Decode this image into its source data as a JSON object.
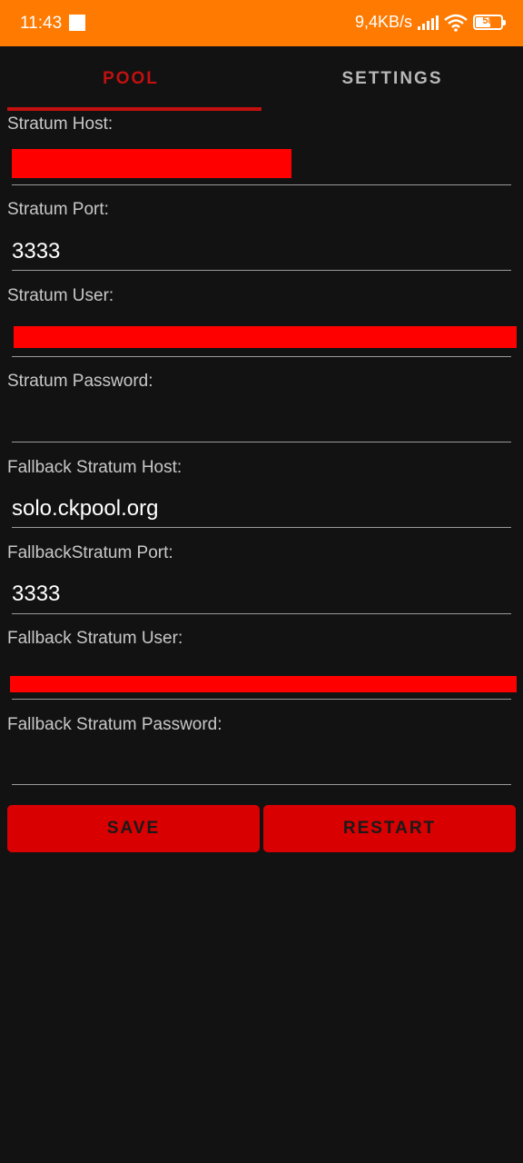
{
  "status_bar": {
    "time": "11:43",
    "network_speed": "9,4KB/s",
    "battery_level": "58",
    "background_color": "#ff7a00",
    "icons": [
      "signal-icon",
      "wifi-icon",
      "battery-icon"
    ]
  },
  "tabs": [
    {
      "label": "POOL",
      "active": true
    },
    {
      "label": "SETTINGS",
      "active": false
    }
  ],
  "accent_color": "#c21010",
  "fields": {
    "stratum_host": {
      "label": "Stratum Host:",
      "value": ""
    },
    "stratum_port": {
      "label": "Stratum Port:",
      "value": "3333"
    },
    "stratum_user": {
      "label": "Stratum User:",
      "value": ""
    },
    "stratum_password": {
      "label": "Stratum Password:",
      "value": ""
    },
    "fallback_host": {
      "label": "Fallback Stratum Host:",
      "value": "solo.ckpool.org"
    },
    "fallback_port": {
      "label": "FallbackStratum Port:",
      "value": "3333"
    },
    "fallback_user": {
      "label": "Fallback Stratum User:",
      "value": ""
    },
    "fallback_password": {
      "label": "Fallback Stratum Password:",
      "value": ""
    }
  },
  "buttons": {
    "save": "SAVE",
    "restart": "RESTART"
  }
}
